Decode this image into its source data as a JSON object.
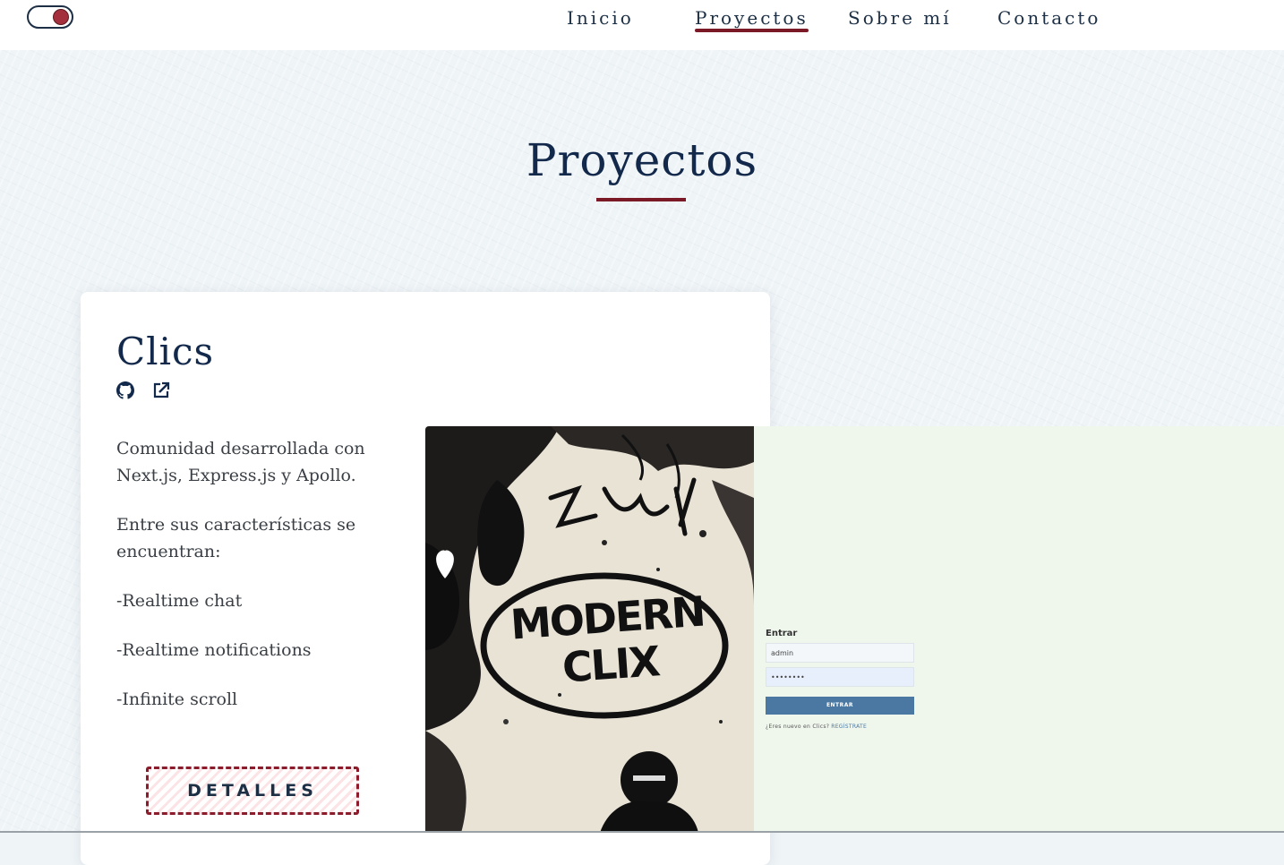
{
  "navbar": {
    "theme_toggle": "on",
    "links": [
      {
        "label": "Inicio",
        "active": false
      },
      {
        "label": "Proyectos",
        "active": true
      },
      {
        "label": "Sobre mí",
        "active": false
      },
      {
        "label": "Contacto",
        "active": false
      }
    ]
  },
  "page": {
    "title": "Proyectos"
  },
  "project": {
    "title": "Clics",
    "links": [
      {
        "icon": "github-icon"
      },
      {
        "icon": "external-link-icon"
      }
    ],
    "description": [
      "Comunidad desarrollada con Next.js, Express.js y Apollo.",
      "Entre sus características se encuentran:",
      "-Realtime chat",
      "-Realtime notifications",
      "-Infinite scroll"
    ],
    "details_label": "DETALLES",
    "preview": {
      "poster_text": [
        "MODERN",
        "CLIX"
      ],
      "login": {
        "heading": "Entrar",
        "username_value": "admin",
        "password_value": "••••••••",
        "submit_label": "ENTRAR",
        "signup_prompt": "¿Eres nuevo en Clics?",
        "signup_link": "REGÍSTRATE"
      }
    }
  },
  "colors": {
    "accent": "#7b1a26",
    "primary": "#13294b",
    "background": "#eff4f7"
  }
}
